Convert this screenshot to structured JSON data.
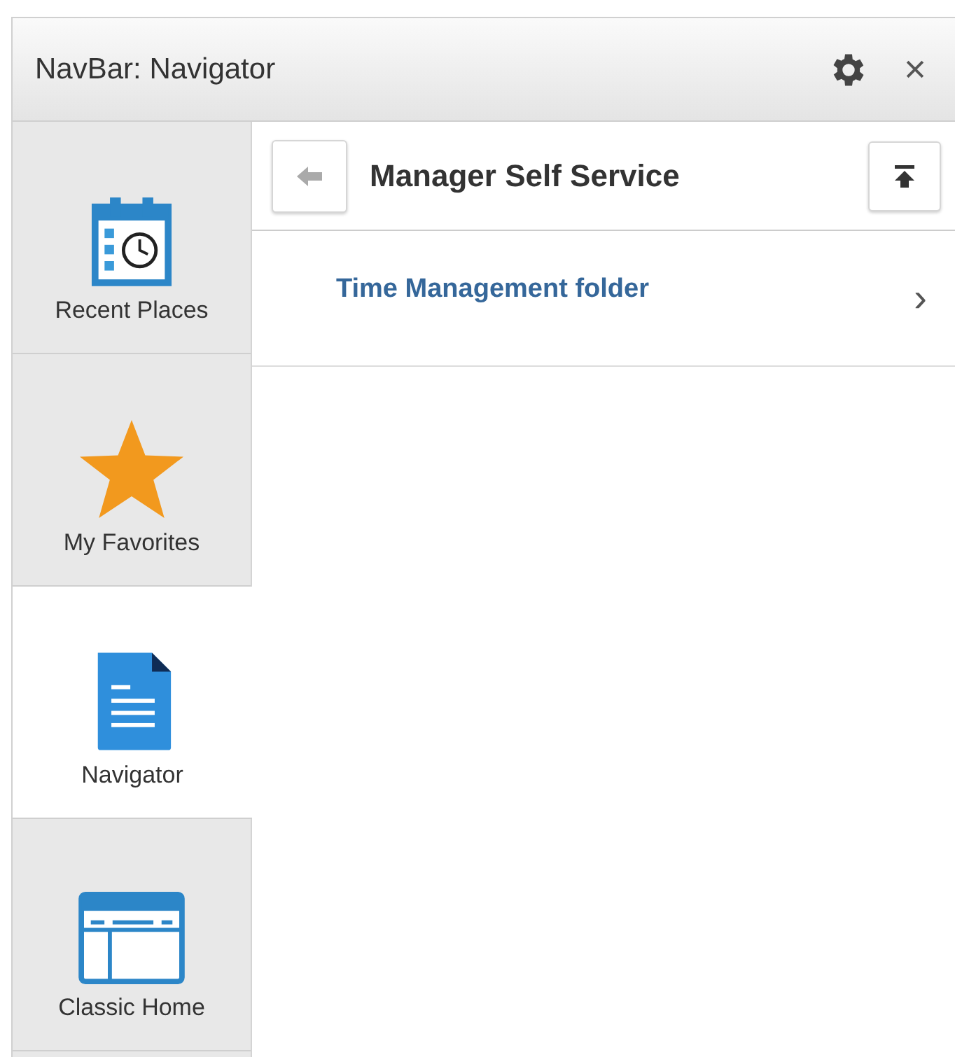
{
  "window": {
    "title": "NavBar: Navigator"
  },
  "sidebar": {
    "items": [
      {
        "label": "Recent Places",
        "kind": "calendar",
        "selected": false
      },
      {
        "label": "My Favorites",
        "kind": "star",
        "selected": false
      },
      {
        "label": "Navigator",
        "kind": "document",
        "selected": true
      },
      {
        "label": "Classic Home",
        "kind": "window",
        "selected": false
      }
    ]
  },
  "content": {
    "title": "Manager Self Service",
    "items": [
      {
        "label": "Time Management folder",
        "chevron": "›"
      }
    ]
  }
}
